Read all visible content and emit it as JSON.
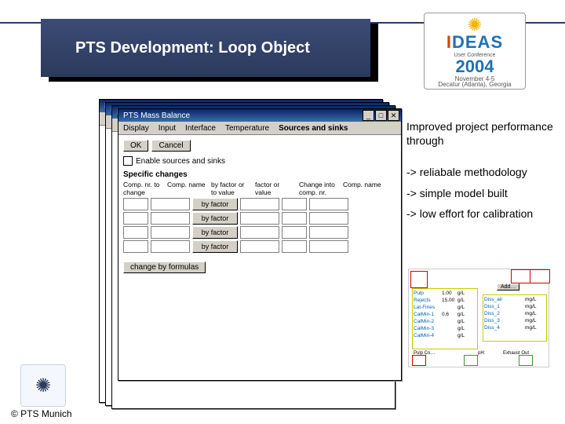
{
  "banner": {
    "title": "PTS Development: Loop Object"
  },
  "logo": {
    "brand": "IDEAS",
    "tag": "User Conference",
    "year": "2004",
    "dates": "November 4-5",
    "place": "Decatur (Atlanta), Georgia"
  },
  "front_window": {
    "title": "PTS Mass Balance",
    "menu": [
      "Display",
      "Input",
      "Interface",
      "Temperature",
      "Sources and sinks"
    ],
    "active_menu_index": 4,
    "close_icon": "✕",
    "max_icon": "□",
    "min_icon": "_",
    "ok": "OK",
    "cancel": "Cancel",
    "enable_label": "Enable sources and sinks",
    "section": "Specific changes",
    "headers": [
      "Comp. nr. to change",
      "Comp. name",
      "by factor or to value",
      "factor or value",
      "Change into comp. nr.",
      "Comp. name"
    ],
    "dd_value": "by factor",
    "rows": 4,
    "formula_btn": "change by formulas"
  },
  "bullets": {
    "lead": "Improved project performance through",
    "items": [
      "-> reliabale methodology",
      "-> simple model built",
      "-> low effort for calibration"
    ]
  },
  "diagram": {
    "unit": "g/L",
    "unit2": "mg/L",
    "rows": [
      {
        "name": "Pulp",
        "v": "1.00"
      },
      {
        "name": "Rejects",
        "v": "15.00"
      },
      {
        "name": "Lat-Fines",
        "v": ""
      },
      {
        "name": "CalMin-1",
        "v": "0.6"
      },
      {
        "name": "CalMin-2",
        "v": ""
      },
      {
        "name": "CalMin-3",
        "v": ""
      },
      {
        "name": "CalMin-4",
        "v": ""
      }
    ],
    "rrows": [
      {
        "name": "Diss_air",
        "v": ""
      },
      {
        "name": "Diss_1",
        "v": ""
      },
      {
        "name": "Diss_2",
        "v": ""
      },
      {
        "name": "Diss_3",
        "v": ""
      },
      {
        "name": "Diss_4",
        "v": ""
      }
    ],
    "bottom_left": "Pulp Co…",
    "bottom_mid": "pH:",
    "bottom_right": "Exhaust Out",
    "add_btn": "Add…"
  },
  "footer": {
    "copyright": "© PTS Munich"
  }
}
